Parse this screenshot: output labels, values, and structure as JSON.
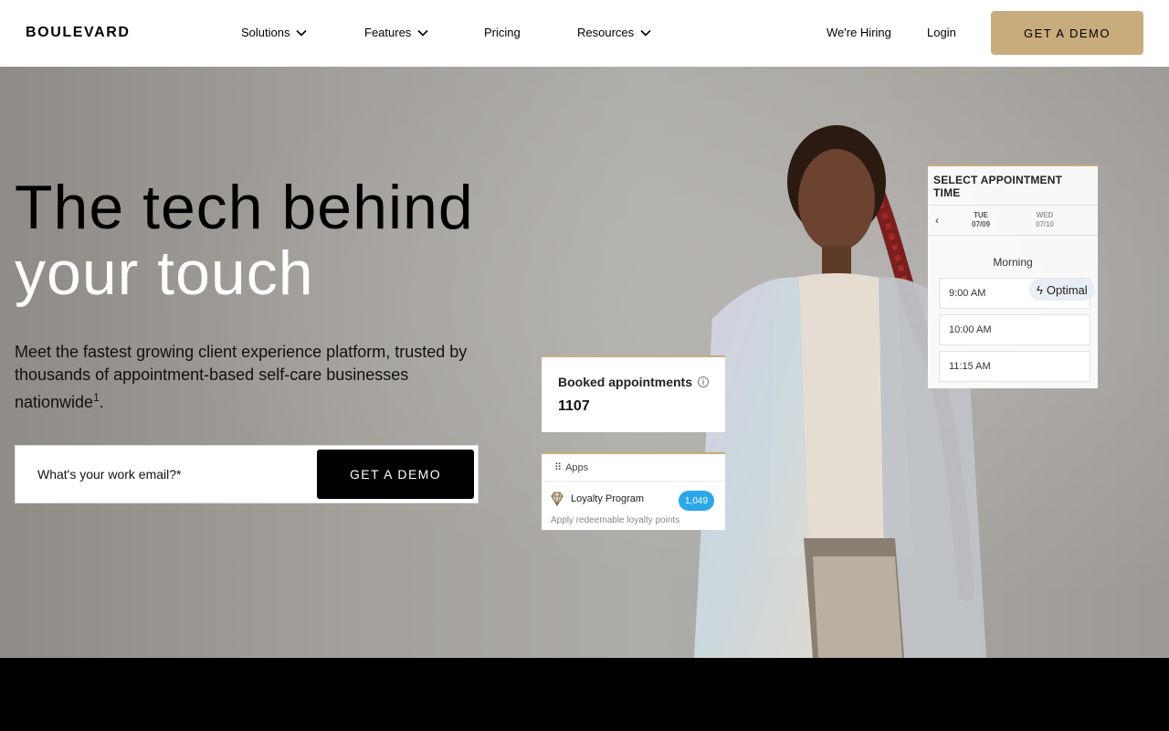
{
  "nav": {
    "logo": "BOULEVARD",
    "items": [
      {
        "label": "Solutions",
        "has_dropdown": true
      },
      {
        "label": "Features",
        "has_dropdown": true
      },
      {
        "label": "Pricing",
        "has_dropdown": false
      },
      {
        "label": "Resources",
        "has_dropdown": true
      }
    ],
    "hiring": "We're Hiring",
    "login": "Login",
    "demo_label": "GET A DEMO"
  },
  "hero": {
    "headline_line1": "The tech behind",
    "headline_line2": "your touch",
    "subtext": "Meet the fastest growing client experience platform, trusted by thousands of appointment-based self-care businesses nationwide",
    "footnote": "1",
    "email_placeholder": "What's your work email?*",
    "demo_label": "GET A DEMO"
  },
  "appointment_card": {
    "title": "SELECT APPOINTMENT TIME",
    "days": [
      {
        "name": "TUE",
        "date": "07/09"
      },
      {
        "name": "WED",
        "date": "07/10"
      }
    ],
    "period": "Morning",
    "slots": [
      "9:00 AM",
      "10:00 AM",
      "11:15 AM"
    ],
    "optimal_label": "Optimal"
  },
  "booked_card": {
    "label": "Booked appointments",
    "value": "1107"
  },
  "apps_card": {
    "header": "Apps",
    "item": "Loyalty Program",
    "count": "1,049",
    "description": "Apply redeemable loyalty points"
  },
  "colors": {
    "accent": "#c9ac7c",
    "badge": "#2aa7e8",
    "dark": "#000000"
  }
}
